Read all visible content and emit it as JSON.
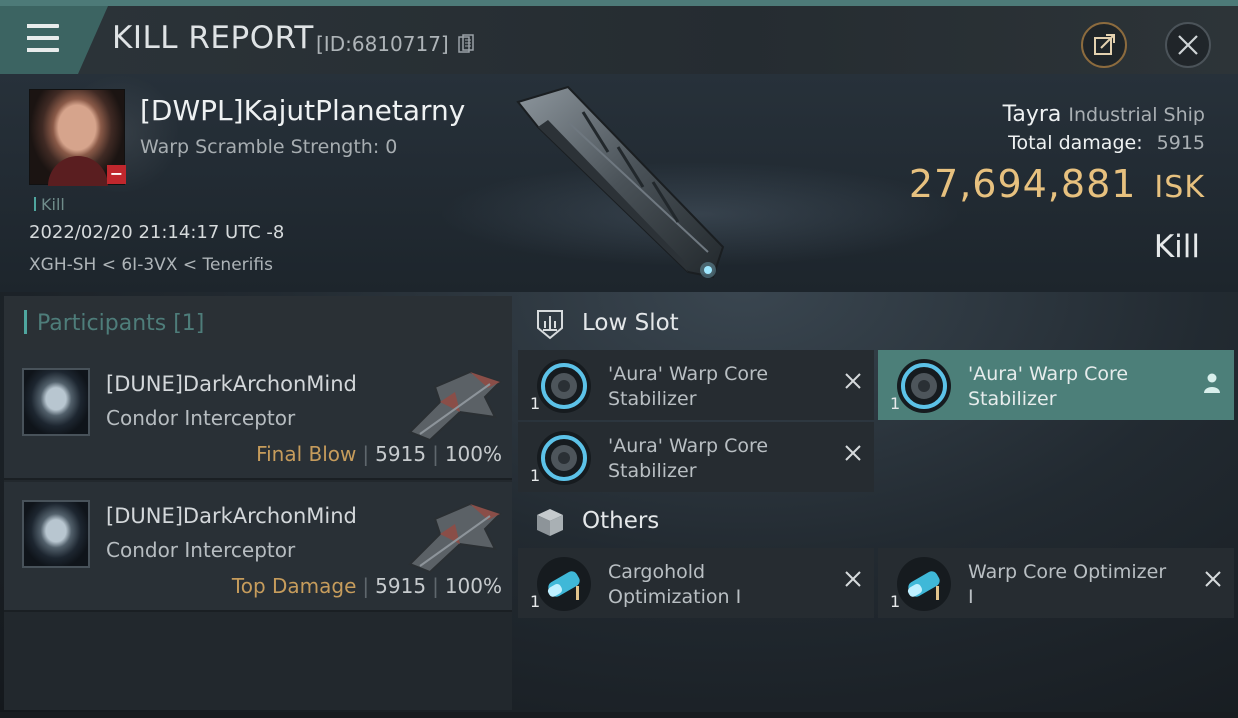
{
  "header": {
    "title": "KILL REPORT",
    "id_label": "[ID:6810717]"
  },
  "victim": {
    "name": "[DWPL]KajutPlanetarny",
    "warp_scramble": "Warp Scramble Strength: 0",
    "kill_tag": "Kill",
    "timestamp": "2022/02/20 21:14:17 UTC -8",
    "location": "XGH-SH < 6I-3VX < Tenerifis"
  },
  "ship": {
    "name": "Tayra",
    "class": "Industrial Ship",
    "total_damage_label": "Total damage:",
    "total_damage": "5915",
    "isk_value": "27,694,881",
    "isk_unit": "ISK",
    "result": "Kill"
  },
  "participants": {
    "title": "Participants [1]",
    "rows": [
      {
        "name": "[DUNE]DarkArchonMind",
        "ship": "Condor Interceptor",
        "role": "Final Blow",
        "damage": "5915",
        "percent": "100%"
      },
      {
        "name": "[DUNE]DarkArchonMind",
        "ship": "Condor Interceptor",
        "role": "Top Damage",
        "damage": "5915",
        "percent": "100%"
      }
    ]
  },
  "fittings": {
    "low_slot": {
      "title": "Low Slot",
      "items": [
        {
          "qty": "1",
          "name": "'Aura' Warp Core Stabilizer",
          "selected": false
        },
        {
          "qty": "1",
          "name": "'Aura' Warp Core Stabilizer",
          "selected": true
        },
        {
          "qty": "1",
          "name": "'Aura' Warp Core Stabilizer",
          "selected": false
        }
      ]
    },
    "others": {
      "title": "Others",
      "items": [
        {
          "qty": "1",
          "name": "Cargohold Optimization I",
          "selected": false
        },
        {
          "qty": "1",
          "name": "Warp Core Optimizer I",
          "selected": false
        }
      ]
    }
  },
  "colors": {
    "accent_teal": "#4c7f79",
    "isk_gold": "#e7c17f",
    "role_gold": "#c69c5c",
    "loss_badge_red": "#c0272d"
  }
}
